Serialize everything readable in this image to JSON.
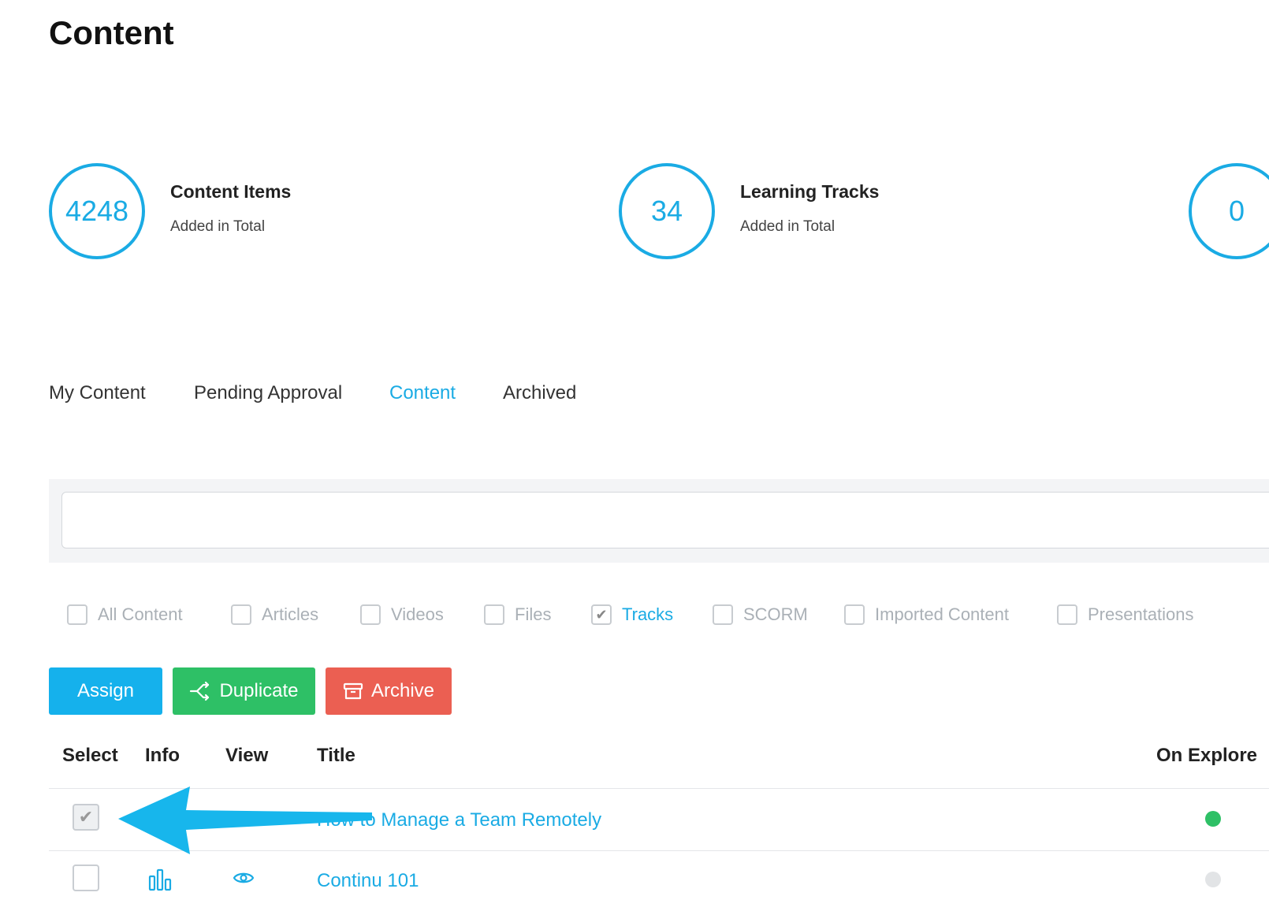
{
  "page": {
    "title": "Content"
  },
  "stats": [
    {
      "value": "4248",
      "title": "Content Items",
      "subtitle": "Added in Total"
    },
    {
      "value": "34",
      "title": "Learning Tracks",
      "subtitle": "Added in Total"
    },
    {
      "value": "0"
    }
  ],
  "tabs": [
    {
      "label": "My Content",
      "active": false
    },
    {
      "label": "Pending Approval",
      "active": false
    },
    {
      "label": "Content",
      "active": true
    },
    {
      "label": "Archived",
      "active": false
    }
  ],
  "search": {
    "value": ""
  },
  "filters": [
    {
      "label": "All Content",
      "checked": false
    },
    {
      "label": "Articles",
      "checked": false
    },
    {
      "label": "Videos",
      "checked": false
    },
    {
      "label": "Files",
      "checked": false
    },
    {
      "label": "Tracks",
      "checked": true
    },
    {
      "label": "SCORM",
      "checked": false
    },
    {
      "label": "Imported Content",
      "checked": false
    },
    {
      "label": "Presentations",
      "checked": false
    }
  ],
  "actions": {
    "assign": "Assign",
    "duplicate": "Duplicate",
    "archive": "Archive"
  },
  "table": {
    "headers": {
      "select": "Select",
      "info": "Info",
      "view": "View",
      "title": "Title",
      "on_explore": "On Explore"
    },
    "rows": [
      {
        "title": "How to Manage a Team Remotely",
        "checked": true,
        "disabled": true,
        "on_explore": "green"
      },
      {
        "title": "Continu 101",
        "checked": false,
        "disabled": false,
        "on_explore": "grey"
      }
    ]
  },
  "colors": {
    "accent": "#1aabe4",
    "assign": "#15b1ec",
    "duplicate": "#2ec066",
    "archive": "#eb5f52",
    "arrow": "#17b6ec"
  }
}
